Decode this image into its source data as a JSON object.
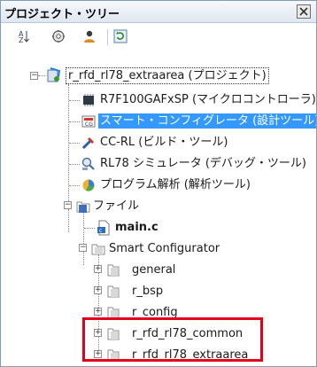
{
  "panel": {
    "title": "プロジェクト・ツリー"
  },
  "toolbar": [
    {
      "icon": "sort-icon"
    },
    {
      "icon": "gear-icon"
    },
    {
      "icon": "user-icon"
    },
    {
      "icon": "refresh-icon"
    }
  ],
  "tree": {
    "project": "r_rfd_rl78_extraarea (プロジェクト)",
    "device": "R7F100GAFxSP (マイクロコントローラ)",
    "configurator": "スマート・コンフィグレータ (設計ツール)",
    "compiler": "CC-RL (ビルド・ツール)",
    "simulator": "RL78 シミュレータ (デバッグ・ツール)",
    "analyzer": "プログラム解析 (解析ツール)",
    "files": "ファイル",
    "main_file": "main.c",
    "smart_config_folder": "Smart Configurator",
    "folders": [
      "general",
      "r_bsp",
      "r_config",
      "r_rfd_rl78_common",
      "r_rfd_rl78_extraarea"
    ]
  },
  "colors": {
    "selection": "#3399ff",
    "highlight_box": "#e3001b"
  }
}
